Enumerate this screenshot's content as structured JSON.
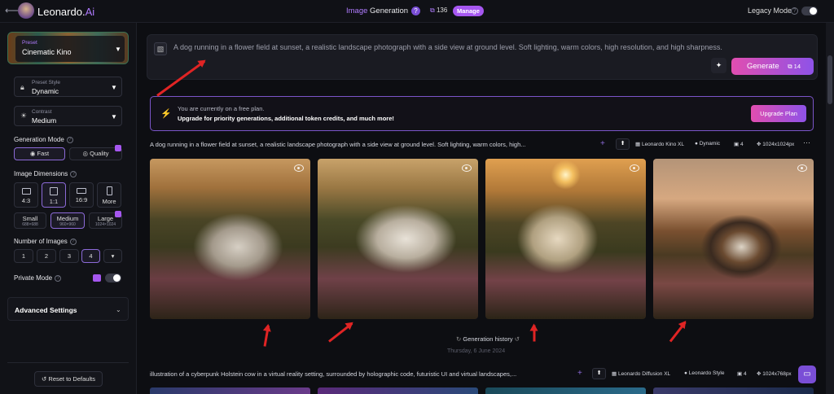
{
  "topbar": {
    "back_icon": "back-arrow-icon",
    "brand_name": "Leonardo.",
    "brand_suffix": "Ai",
    "title_prefix": "Image",
    "title_suffix": " Generation",
    "help_mark": "?",
    "token_count": "136",
    "manage_label": "Manage",
    "legacy_label": "Legacy Mode",
    "legacy_help": "?",
    "legacy_mode_on": false
  },
  "sidebar": {
    "preset_label": "Preset",
    "preset_value": "Cinematic Kino",
    "preset_style_label": "Preset Style",
    "preset_style_value": "Dynamic",
    "contrast_label": "Contrast",
    "contrast_value": "Medium",
    "generation_mode_label": "Generation Mode",
    "mode_fast": "Fast",
    "mode_quality": "Quality",
    "image_dimensions_label": "Image Dimensions",
    "ratios": [
      "4:3",
      "1:1",
      "16:9",
      "More"
    ],
    "sizes": [
      {
        "label": "Small",
        "sub": "688×688"
      },
      {
        "label": "Medium",
        "sub": "960×960"
      },
      {
        "label": "Large",
        "sub": "1024×1024"
      }
    ],
    "num_images_label": "Number of Images",
    "num_options": [
      "1",
      "2",
      "3",
      "4",
      "▾"
    ],
    "private_mode_label": "Private Mode",
    "private_mode_on": false,
    "advanced_label": "Advanced Settings",
    "reset_label": "Reset to Defaults"
  },
  "prompt": {
    "text": "A dog running in a flower field at sunset, a realistic landscape photograph with a side view at ground level. Soft lighting, warm colors, high resolution, and high sharpness.",
    "generate_label": "Generate",
    "generate_cost": "14"
  },
  "banner": {
    "line1": "You are currently on a free plan.",
    "line2": "Upgrade for priority generations, additional token credits, and much more!",
    "upgrade_label": "Upgrade Plan"
  },
  "generations": [
    {
      "prompt": "A dog running in a flower field at sunset, a realistic landscape photograph with a side view at ground level. Soft lighting, warm colors, high...",
      "model": "Leonardo Kino XL",
      "style": "Dynamic",
      "count": "4",
      "size": "1024x1024px"
    },
    {
      "prompt": "illustration of a cyberpunk Holstein cow in a virtual reality setting, surrounded by holographic code, futuristic UI and virtual landscapes,...",
      "model": "Leonardo Diffusion XL",
      "style": "Leonardo Style",
      "count": "4",
      "size": "1024x768px"
    }
  ],
  "history": {
    "label": "Generation history",
    "date": "Thursday, 6 June 2024"
  },
  "colors": {
    "accent": "#a657f0",
    "generate_gradient_start": "#e14eb0",
    "generate_gradient_end": "#8e52e8",
    "arrow": "#e02424"
  }
}
